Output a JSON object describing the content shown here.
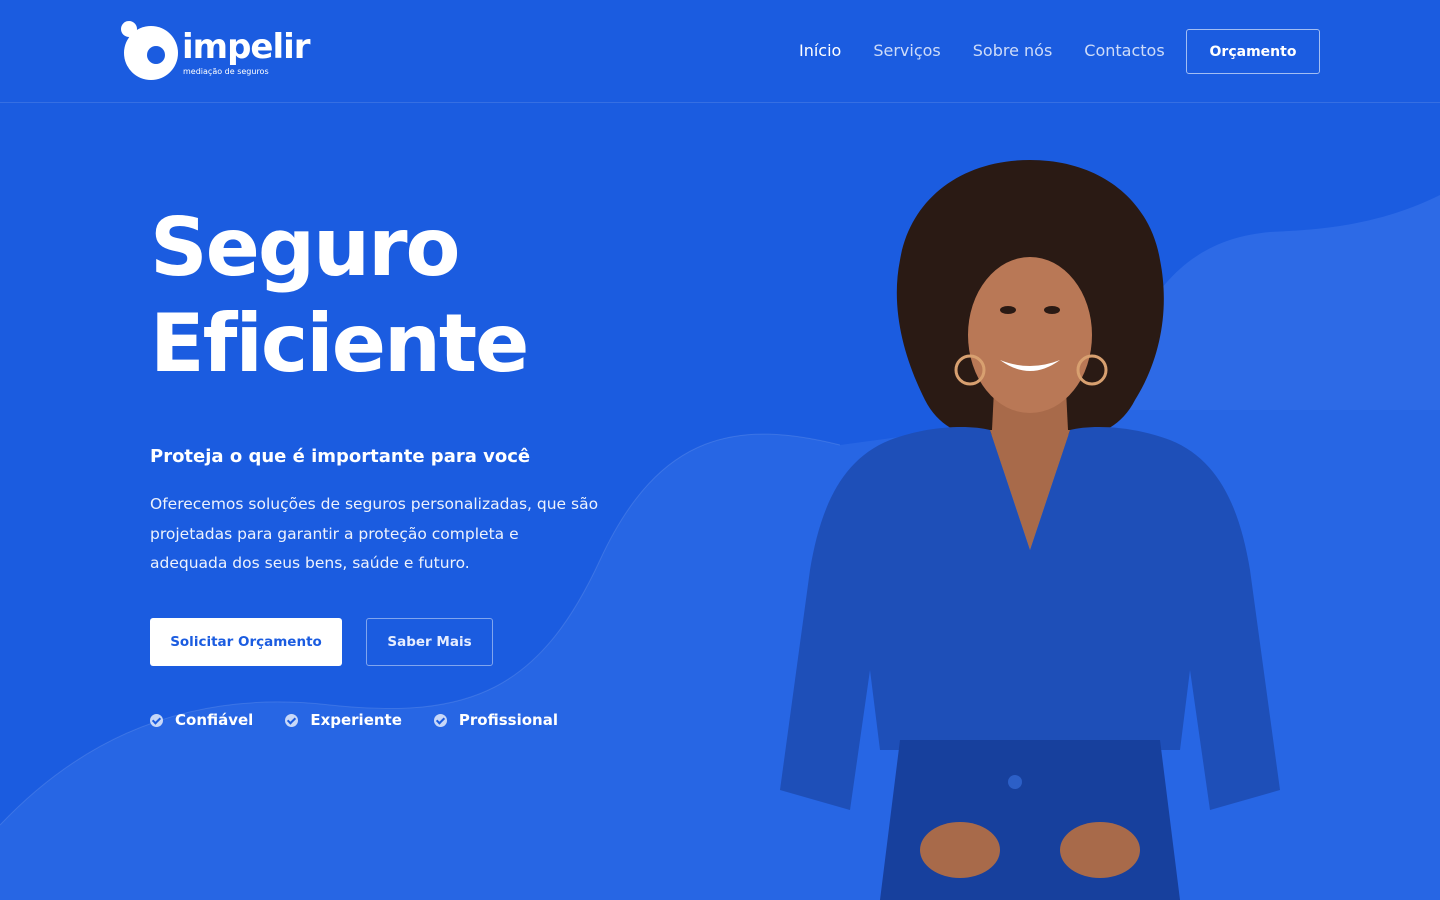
{
  "brand": {
    "name": "impelir",
    "tagline": "mediação de seguros"
  },
  "nav": {
    "items": [
      {
        "label": "Início",
        "active": true
      },
      {
        "label": "Serviços",
        "active": false
      },
      {
        "label": "Sobre nós",
        "active": false
      },
      {
        "label": "Contactos",
        "active": false
      }
    ],
    "cta_label": "Orçamento"
  },
  "hero": {
    "title_line1": "Seguro",
    "title_line2": "Eficiente",
    "subtitle": "Proteja o que é importante para você",
    "description": "Oferecemos soluções de seguros personalizadas, que são projetadas para garantir a proteção completa e adequada dos seus bens, saúde e futuro.",
    "primary_button": "Solicitar Orçamento",
    "secondary_button": "Saber Mais",
    "features": [
      "Confiável",
      "Experiente",
      "Profissional"
    ]
  },
  "colors": {
    "background": "#1b5ce0",
    "wave": "#2d6ae6",
    "text": "#ffffff",
    "blouse": "#1e4fb8"
  },
  "icons": [
    "logo-mark-icon",
    "check-circle-icon"
  ]
}
